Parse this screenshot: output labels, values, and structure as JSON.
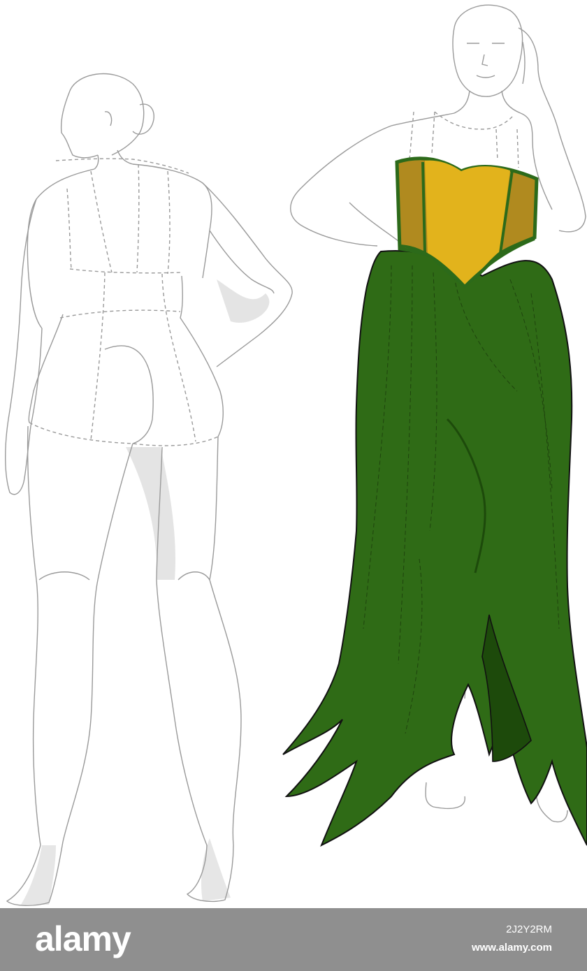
{
  "watermark": {
    "brand": "alamy",
    "image_id": "2J2Y2RM",
    "url": "www.alamy.com"
  },
  "colors": {
    "background": "#ffffff",
    "bar": "#8f8f8f",
    "sketch_line": "#9a9a9a",
    "shadow": "#e2e2e2",
    "skirt_green": "#2f6b16",
    "skirt_dark": "#1d4a0b",
    "bodice_gold": "#e2b31c",
    "bodice_side": "#b08a1f",
    "trim_green": "#2c6a1a"
  },
  "icons": {
    "back_figure": "croquis-back-view-icon",
    "front_figure": "croquis-front-dress-icon"
  }
}
